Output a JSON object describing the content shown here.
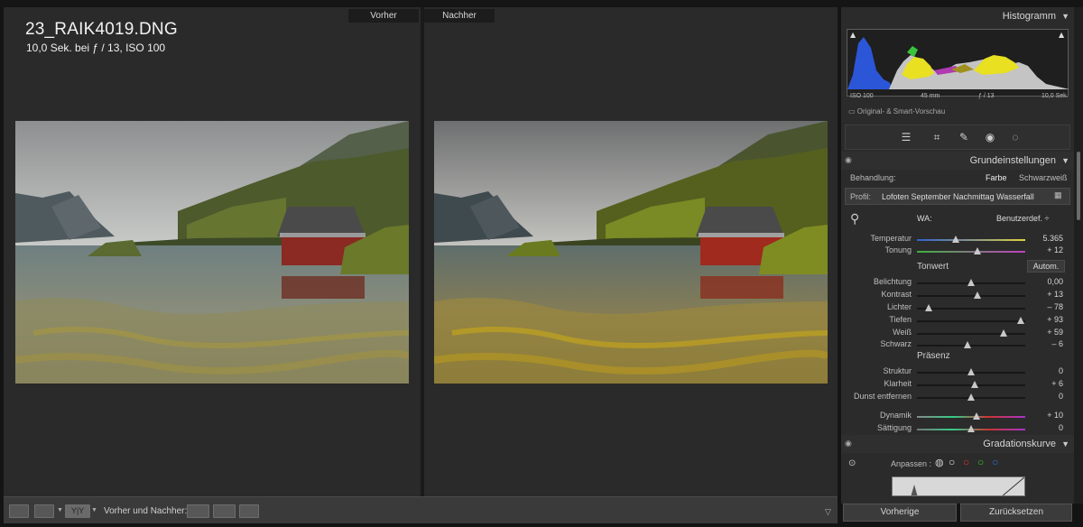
{
  "file": {
    "name": "23_RAIK4019.DNG",
    "info": "10,0 Sek. bei ƒ / 13, ISO 100"
  },
  "compare": {
    "before_label": "Vorher",
    "after_label": "Nachher"
  },
  "toolbar": {
    "label": "Vorher und Nachher:",
    "yy_label": "Y|Y"
  },
  "histogram": {
    "title": "Histogramm",
    "iso": "ISO 100",
    "focal": "45 mm",
    "aperture": "ƒ / 13",
    "shutter": "10,0 Sek.",
    "smart_preview": "Original- & Smart-Vorschau"
  },
  "basic": {
    "title": "Grundeinstellungen",
    "treatment_label": "Behandlung:",
    "treatment_color": "Farbe",
    "treatment_bw": "Schwarzweiß",
    "profile_label": "Profil:",
    "profile_value": "Lofoten September Nachmittag Wasserfall bew...",
    "wb_label": "WA:",
    "wb_value": "Benutzerdef. ÷",
    "tone_title": "Tonwert",
    "auto_label": "Autom.",
    "presence_title": "Präsenz",
    "sliders": [
      {
        "label": "Temperatur",
        "value": "5.365",
        "pos": 0.36,
        "grad": "temp"
      },
      {
        "label": "Tonung",
        "value": "+ 12",
        "pos": 0.56,
        "grad": "tint"
      },
      {
        "label": "Belichtung",
        "value": "0,00",
        "pos": 0.5,
        "grad": "none"
      },
      {
        "label": "Kontrast",
        "value": "+ 13",
        "pos": 0.56,
        "grad": "none"
      },
      {
        "label": "Lichter",
        "value": "– 78",
        "pos": 0.11,
        "grad": "none"
      },
      {
        "label": "Tiefen",
        "value": "+ 93",
        "pos": 0.96,
        "grad": "none"
      },
      {
        "label": "Weiß",
        "value": "+ 59",
        "pos": 0.8,
        "grad": "none"
      },
      {
        "label": "Schwarz",
        "value": "– 6",
        "pos": 0.47,
        "grad": "none"
      },
      {
        "label": "Struktur",
        "value": "0",
        "pos": 0.5,
        "grad": "none"
      },
      {
        "label": "Klarheit",
        "value": "+ 6",
        "pos": 0.53,
        "grad": "none"
      },
      {
        "label": "Dunst entfernen",
        "value": "0",
        "pos": 0.5,
        "grad": "none"
      },
      {
        "label": "Dynamik",
        "value": "+ 10",
        "pos": 0.55,
        "grad": "vib"
      },
      {
        "label": "Sättigung",
        "value": "0",
        "pos": 0.5,
        "grad": "sat"
      }
    ]
  },
  "curve": {
    "title": "Gradationskurve",
    "adjust_label": "Anpassen :"
  },
  "buttons": {
    "previous": "Vorherige",
    "reset": "Zurücksetzen"
  }
}
